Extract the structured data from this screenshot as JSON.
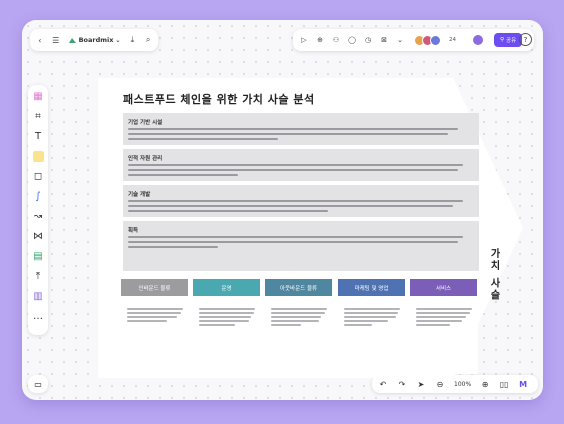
{
  "app": {
    "name": "Boardmix"
  },
  "toolbar": {
    "collaborator_count": "24",
    "share_label": "공유"
  },
  "zoom": "100%",
  "board": {
    "title": "패스트푸드 체인을 위한 가치 사슬 분석",
    "value_chain_label": "가치 사슬",
    "sections": [
      {
        "heading": "기업 기반 시설"
      },
      {
        "heading": "인적 자원 관리"
      },
      {
        "heading": "기술 개발"
      },
      {
        "heading": "획득"
      }
    ],
    "primary_activities": [
      {
        "label": "인바운드 물류",
        "color": "#9c9c9f"
      },
      {
        "label": "운영",
        "color": "#4aa9b0"
      },
      {
        "label": "아웃바운드 물류",
        "color": "#4f86a0"
      },
      {
        "label": "마케팅 및 영업",
        "color": "#4f72b3"
      },
      {
        "label": "서비스",
        "color": "#7a5eb8"
      }
    ]
  },
  "colors": {
    "background": "#b9a6f2",
    "accent": "#6d4cf0"
  }
}
